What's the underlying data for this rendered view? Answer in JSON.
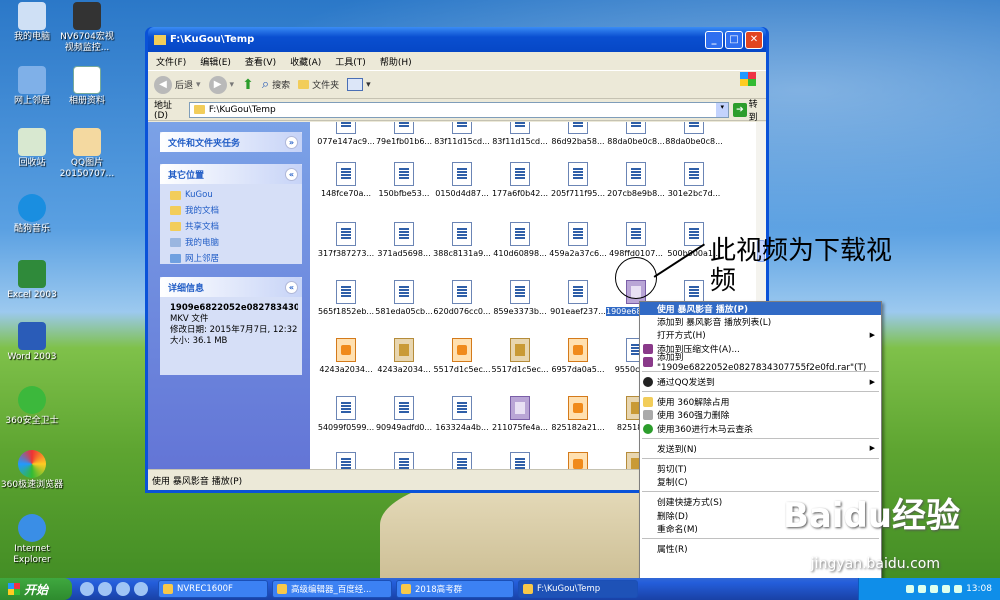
{
  "desktop": {
    "icons_col1": [
      "我的电脑",
      "网上邻居",
      "回收站",
      "酷狗音乐",
      "Excel 2003",
      "Word 2003",
      "360安全卫士",
      "360极速浏览器",
      "Internet Explorer"
    ],
    "icons_col2": [
      "NV6704宏视视频监控...",
      "相册资料",
      "QQ图片20150707..."
    ]
  },
  "window": {
    "title": "F:\\KuGou\\Temp",
    "menu": [
      "文件(F)",
      "编辑(E)",
      "查看(V)",
      "收藏(A)",
      "工具(T)",
      "帮助(H)"
    ],
    "toolbar": {
      "back": "后退",
      "search": "搜索",
      "folders": "文件夹"
    },
    "address": {
      "label": "地址(D)",
      "path": "F:\\KuGou\\Temp",
      "go": "转到"
    },
    "tasks_panel": {
      "title": "文件和文件夹任务"
    },
    "other_places": {
      "title": "其它位置",
      "items": [
        "KuGou",
        "我的文档",
        "共享文档",
        "我的电脑",
        "网上邻居"
      ]
    },
    "details": {
      "title": "详细信息",
      "filename": "1909e6822052e0827834307",
      "type": "MKV 文件",
      "modified": "修改日期: 2015年7月7日, 12:32",
      "size": "大小: 36.1 MB"
    },
    "status": "使用 暴风影音 播放(P)"
  },
  "files": [
    [
      "077e147ac9...",
      "79e1fb01b6...",
      "83f11d15cd...",
      "83f11d15cd...",
      "86d92ba58...",
      "88da0be0c8...",
      "88da0be0c8..."
    ],
    [
      "148fce70a...",
      "150bfbe53...",
      "0150d4d87...",
      "177a6f0b42...",
      "205f711f95...",
      "207cb8e9b8...",
      "301e2bc7d..."
    ],
    [
      "317f387273...",
      "371ad5698...",
      "388c8131a9...",
      "410d60898...",
      "459a2a37c6...",
      "498ffd0107...",
      "500b900a1..."
    ],
    [
      "565f1852eb...",
      "581eda05cb...",
      "620d076cc0...",
      "859e3373b...",
      "901eaef237...",
      "1909e6822052e08278...7755f2...",
      "..."
    ],
    [
      "4243a2034...",
      "4243a2034...",
      "5517d1c5ec...",
      "5517d1c5ec...",
      "6957da0a5...",
      "9550c19...",
      ""
    ],
    [
      "54099f0599...",
      "90949adfd0...",
      "163324a4b...",
      "211075fe4a...",
      "825182a21...",
      "825182...",
      ""
    ],
    [
      "",
      "",
      "",
      "",
      "",
      "",
      ""
    ]
  ],
  "context_menu": [
    "使用 暴风影音 播放(P)",
    "添加到 暴风影音 播放列表(L)",
    "打开方式(H)",
    "添加到压缩文件(A)...",
    "添加到 \"1909e6822052e0827834307755f2e0fd.rar\"(T)",
    "通过QQ发送到",
    "使用 360解除占用",
    "使用 360强力删除",
    "使用360进行木马云查杀",
    "发送到(N)",
    "剪切(T)",
    "复制(C)",
    "创建快捷方式(S)",
    "删除(D)",
    "重命名(M)",
    "属性(R)"
  ],
  "annotation": "此视频为下载视频",
  "taskbar": {
    "start": "开始",
    "tasks": [
      "NVREC1600F",
      "高级编辑器_百度经...",
      "2018高考群",
      "F:\\KuGou\\Temp"
    ],
    "clock": "13:08"
  },
  "watermark": {
    "logo": "Baidu经验",
    "url": "jingyan.baidu.com"
  }
}
